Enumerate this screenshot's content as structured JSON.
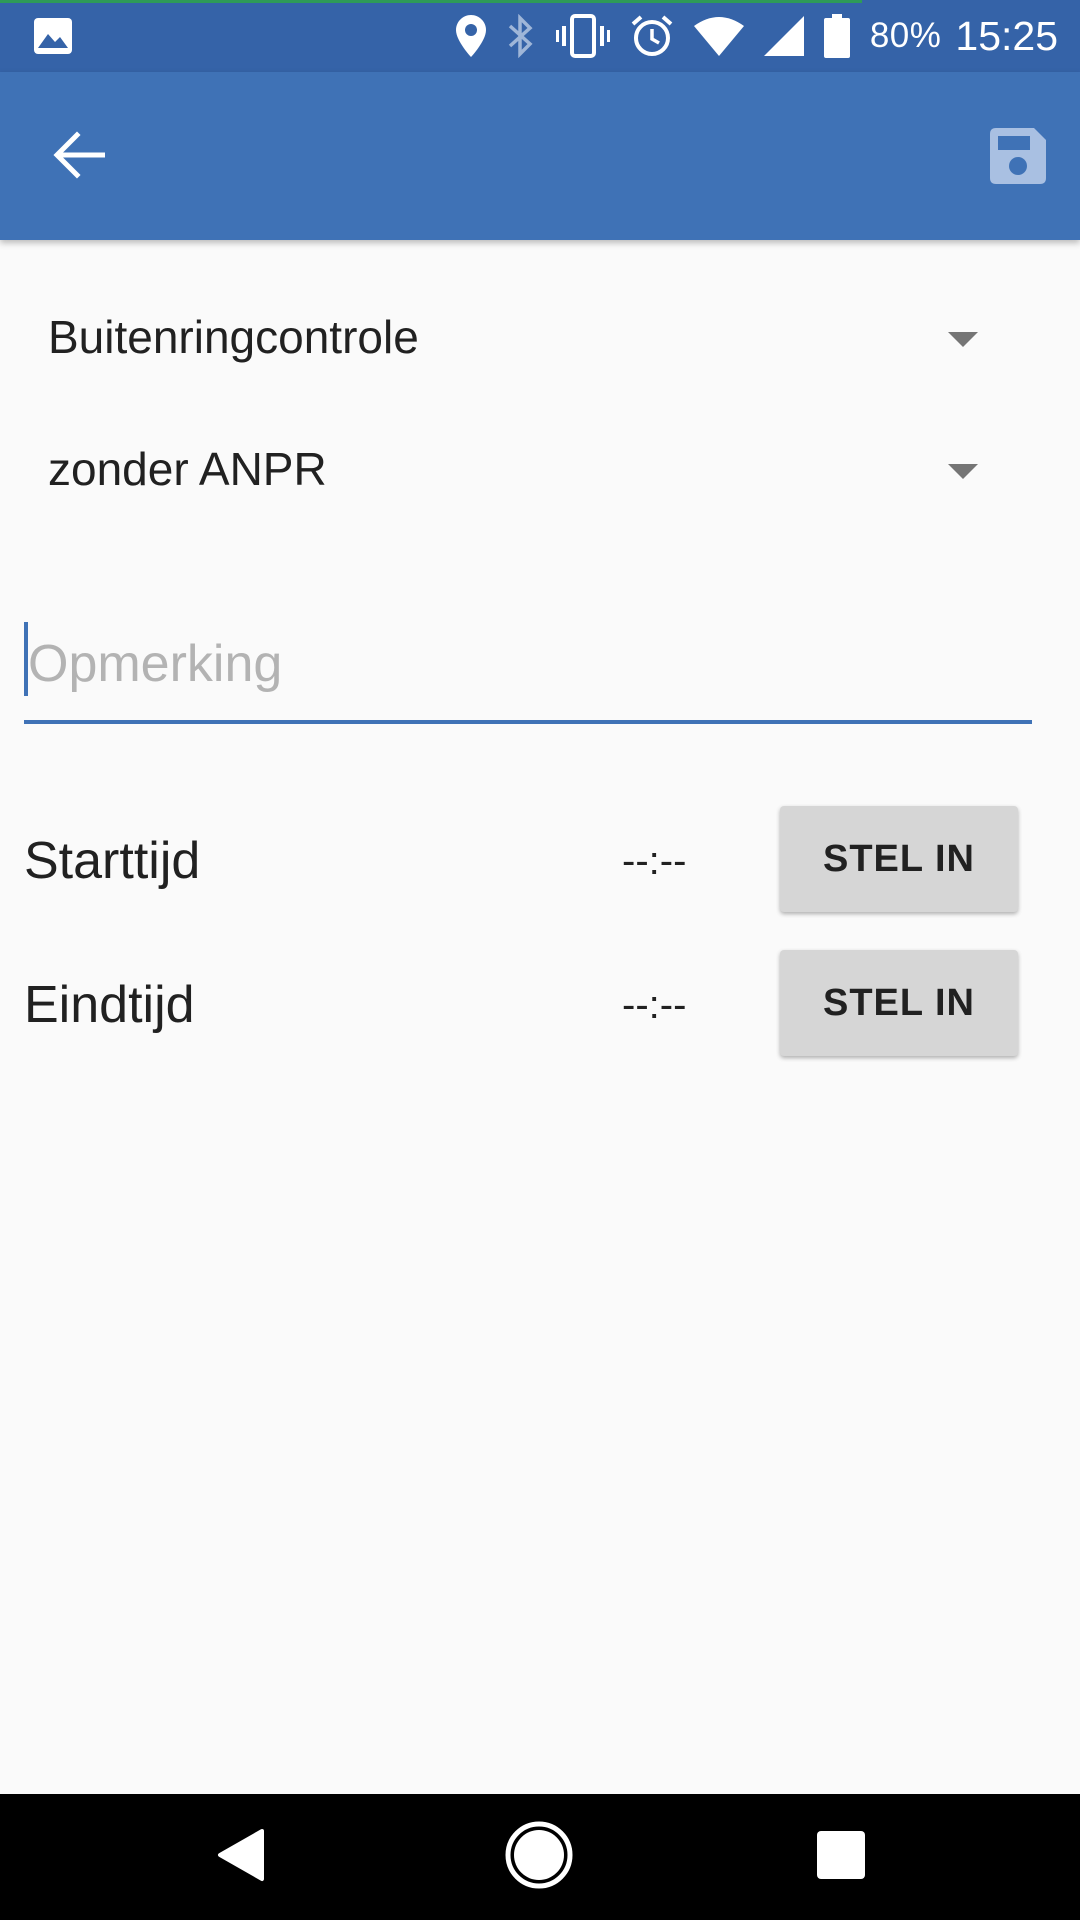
{
  "colors": {
    "status_bar": "#3563a8",
    "app_bar": "#3f72b6",
    "accent": "#3f72b6",
    "background": "#fafafa",
    "button": "#d6d6d6",
    "nav_bar": "#000000"
  },
  "status_bar": {
    "notification_icon": "image-icon",
    "icons": [
      "location-icon",
      "bluetooth-icon",
      "vibrate-icon",
      "alarm-icon",
      "wifi-icon",
      "signal-icon",
      "battery-icon"
    ],
    "battery": "80%",
    "time": "15:25"
  },
  "app_bar": {
    "back_icon": "arrow-back-icon",
    "save_icon": "save-icon"
  },
  "form": {
    "type_spinner": {
      "selected": "Buitenringcontrole"
    },
    "mode_spinner": {
      "selected": "zonder ANPR"
    },
    "remark": {
      "value": "",
      "placeholder": "Opmerking"
    },
    "start": {
      "label": "Starttijd",
      "value": "--:--",
      "button": "STEL IN"
    },
    "end": {
      "label": "Eindtijd",
      "value": "--:--",
      "button": "STEL IN"
    }
  },
  "nav_bar": {
    "icons": [
      "nav-back-icon",
      "nav-home-icon",
      "nav-recents-icon"
    ]
  }
}
